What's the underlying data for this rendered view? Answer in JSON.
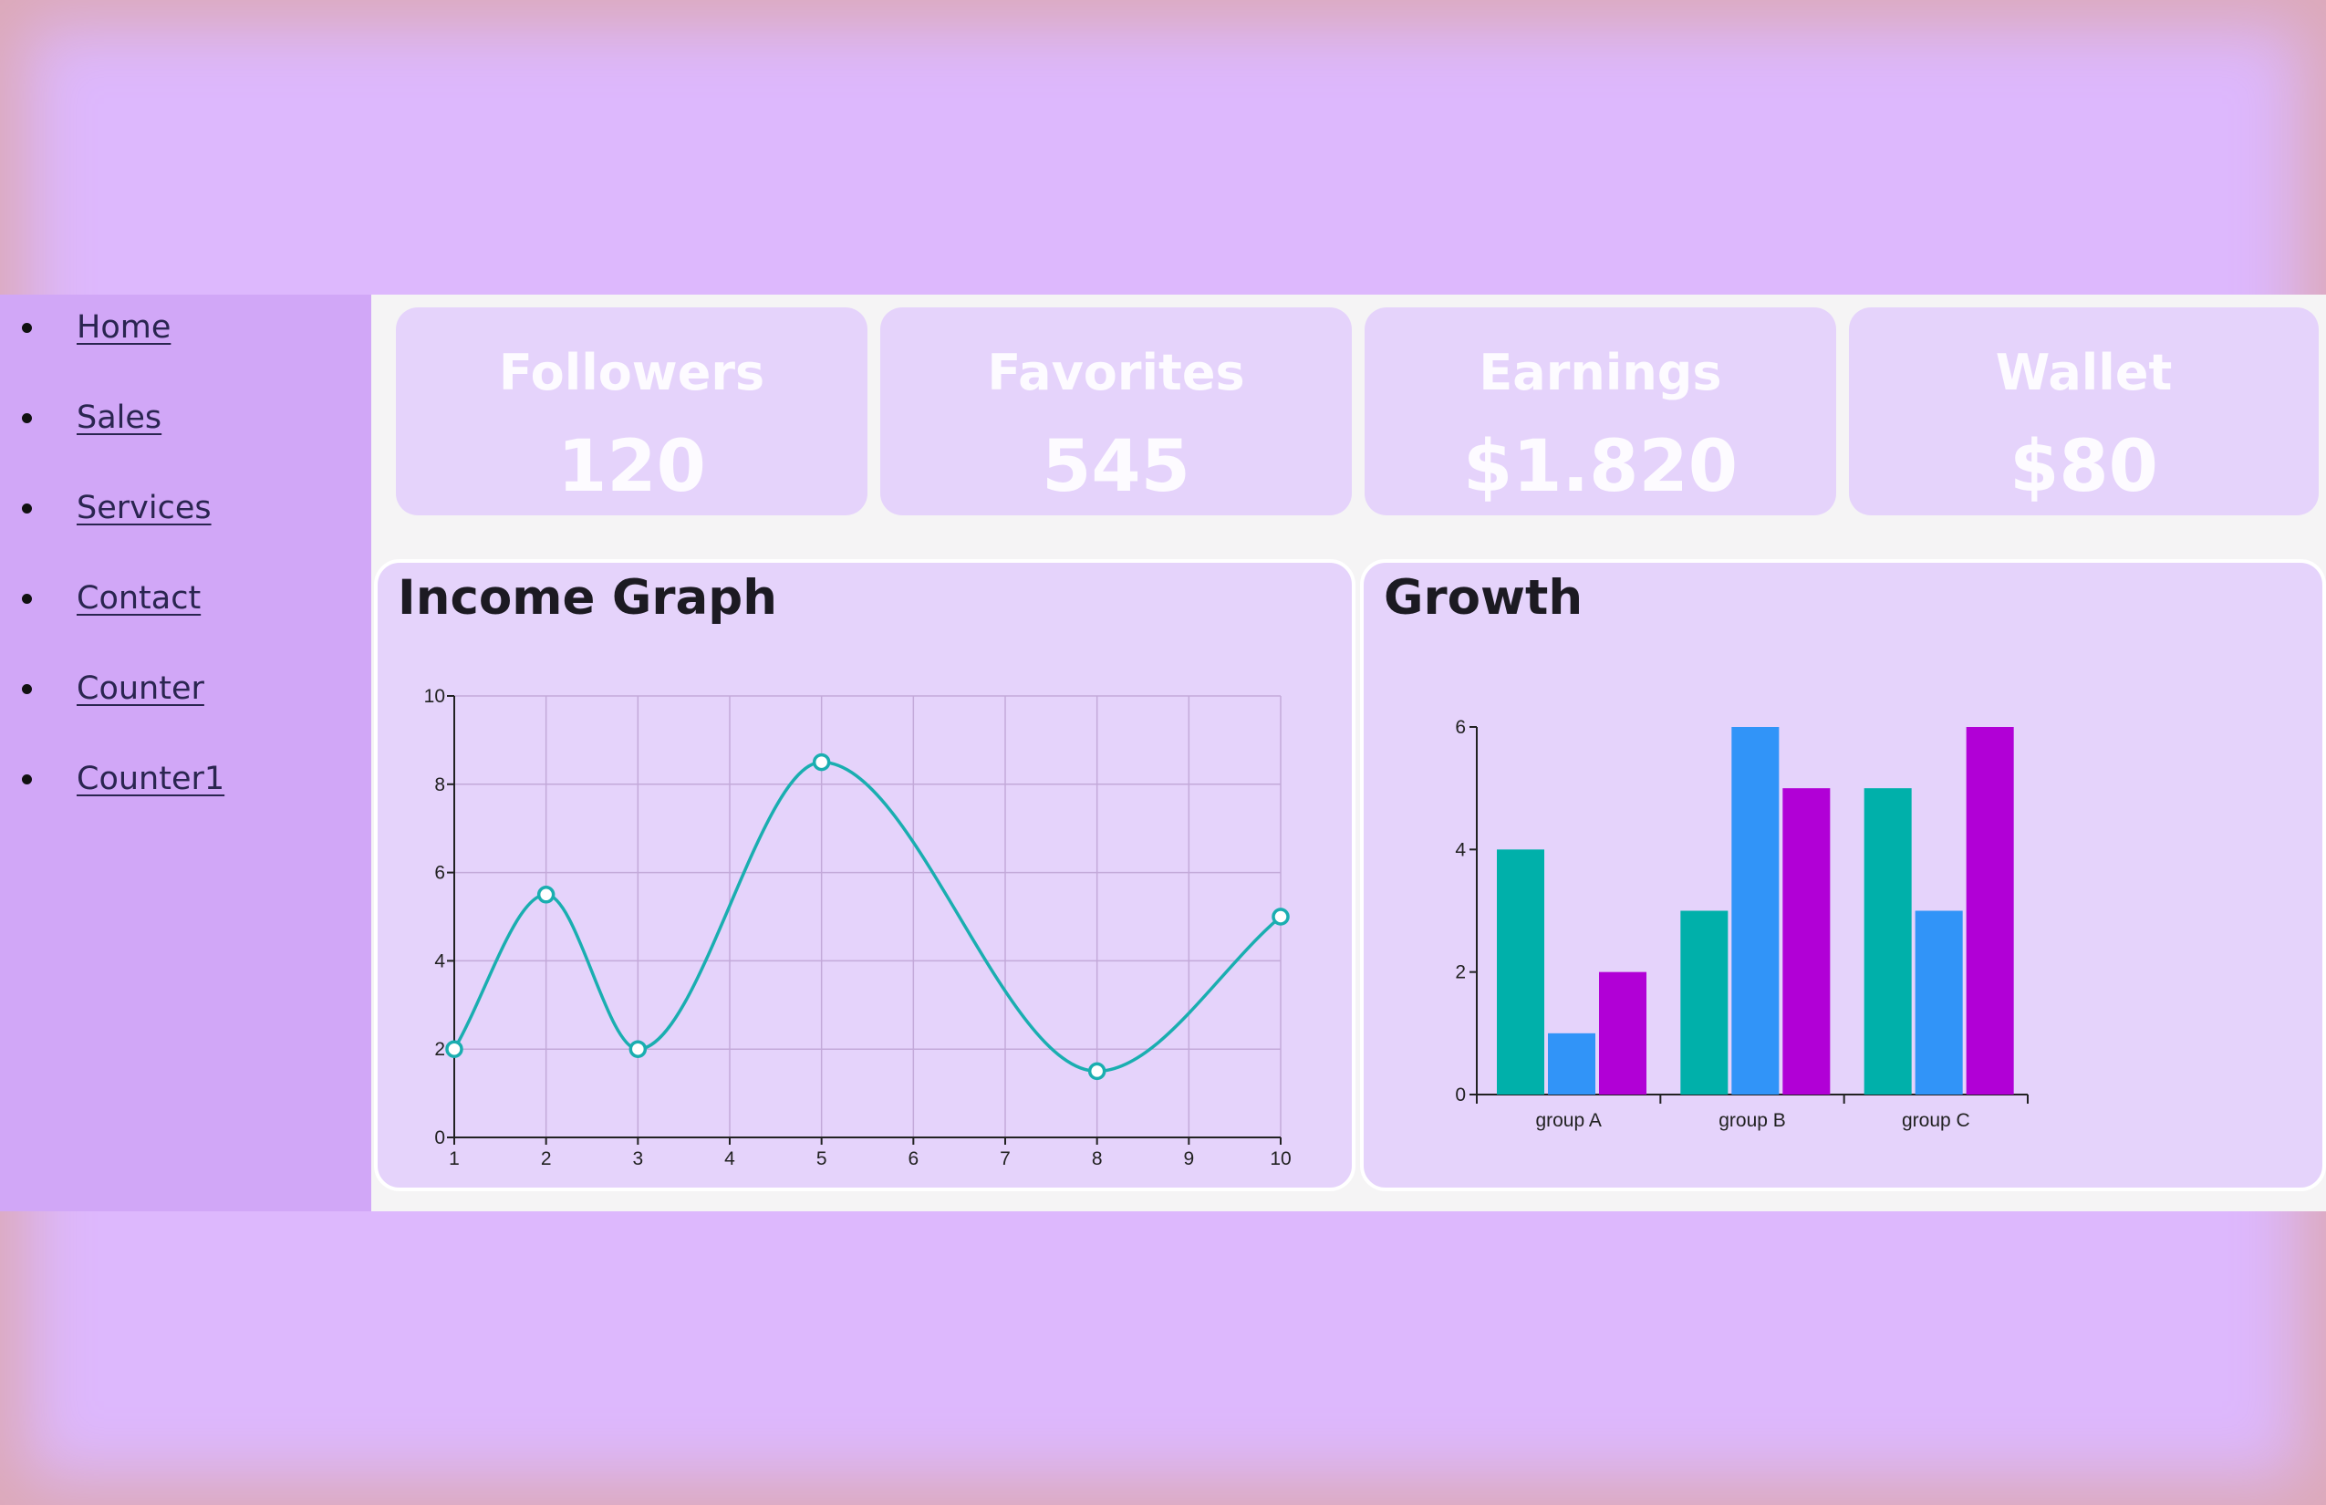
{
  "nav": {
    "items": [
      {
        "label": "Home"
      },
      {
        "label": "Sales"
      },
      {
        "label": "Services"
      },
      {
        "label": "Contact"
      },
      {
        "label": "Counter"
      },
      {
        "label": "Counter1"
      }
    ]
  },
  "stats": [
    {
      "label": "Followers",
      "value": "120"
    },
    {
      "label": "Favorites",
      "value": "545"
    },
    {
      "label": "Earnings",
      "value": "$1.820"
    },
    {
      "label": "Wallet",
      "value": "$80"
    }
  ],
  "colors": {
    "page_background": "#ddb8fd",
    "sidebar": "#d1a7f7",
    "card": "#e5d3fb",
    "line": "#1aaeb0",
    "bar_series_1": "#00b0aa",
    "bar_series_2": "#3194f8",
    "bar_series_3": "#b100d6"
  },
  "chart_data": [
    {
      "type": "line",
      "title": "Income Graph",
      "x": [
        1,
        2,
        3,
        5,
        8,
        10
      ],
      "series": [
        {
          "values": [
            2,
            5.5,
            2,
            8.5,
            1.5,
            5
          ]
        }
      ],
      "x_ticks": [
        1,
        2,
        3,
        4,
        5,
        6,
        7,
        8,
        9,
        10
      ],
      "y_ticks": [
        0,
        2,
        4,
        6,
        8,
        10
      ],
      "xlim": [
        1,
        10
      ],
      "ylim": [
        0,
        10
      ],
      "grid": true,
      "curve": "smooth",
      "markers": "hollow-circles"
    },
    {
      "type": "bar",
      "title": "Growth",
      "categories": [
        "group A",
        "group B",
        "group C"
      ],
      "series": [
        {
          "values": [
            4,
            3,
            5
          ]
        },
        {
          "values": [
            1,
            6,
            3
          ]
        },
        {
          "values": [
            2,
            5,
            6
          ]
        }
      ],
      "y_ticks": [
        0,
        2,
        4,
        6
      ],
      "ylim": [
        0,
        6
      ],
      "grid": false
    }
  ]
}
